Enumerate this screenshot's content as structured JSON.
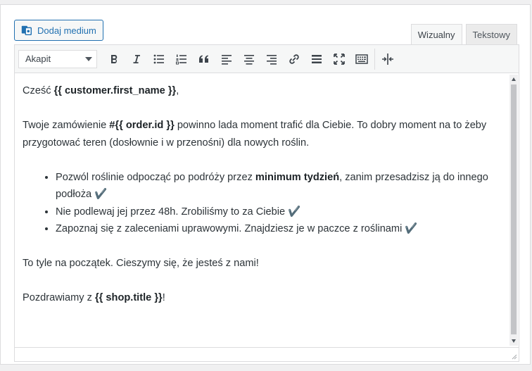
{
  "toolbar_top": {
    "add_media_label": "Dodaj medium",
    "tabs": [
      {
        "label": "Wizualny",
        "active": true
      },
      {
        "label": "Tekstowy",
        "active": false
      }
    ]
  },
  "format_toolbar": {
    "format_select_value": "Akapit",
    "buttons": [
      "bold-icon",
      "italic-icon",
      "bulleted-list-icon",
      "numbered-list-icon",
      "blockquote-icon",
      "align-left-icon",
      "align-center-icon",
      "align-right-icon",
      "link-icon",
      "horizontal-line-icon",
      "fullscreen-icon",
      "toolbar-toggle-icon",
      "read-more-icon"
    ]
  },
  "content": {
    "greeting_prefix": "Cześć ",
    "greeting_var": "{{ customer.first_name }}",
    "greeting_suffix": ",",
    "p2_prefix": "Twoje zamówienie ",
    "p2_var": "#{{ order.id }}",
    "p2_suffix": " powinno lada moment trafić dla Ciebie. To dobry moment na to żeby przygotować teren (dosłownie i w przenośni) dla nowych roślin.",
    "li1_prefix": "Pozwól roślinie odpocząć po podróży przez ",
    "li1_bold": "minimum tydzień",
    "li1_suffix": ", zanim przesadzisz ją do innego podłoża ✔️",
    "li2": "Nie podlewaj jej przez 48h. Zrobiliśmy to za Ciebie ✔️",
    "li3": "Zapoznaj się z zaleceniami uprawowymi. Znajdziesz je w paczce z roślinami ✔️",
    "p4": "To tyle na początek. Cieszymy się, że jesteś z nami!",
    "p5_prefix": "Pozdrawiamy z ",
    "p5_var": "{{ shop.title }}",
    "p5_suffix": "!"
  },
  "colors": {
    "accent": "#2271b1",
    "border": "#dcdcde",
    "toolbar_bg": "#f6f7f7"
  }
}
